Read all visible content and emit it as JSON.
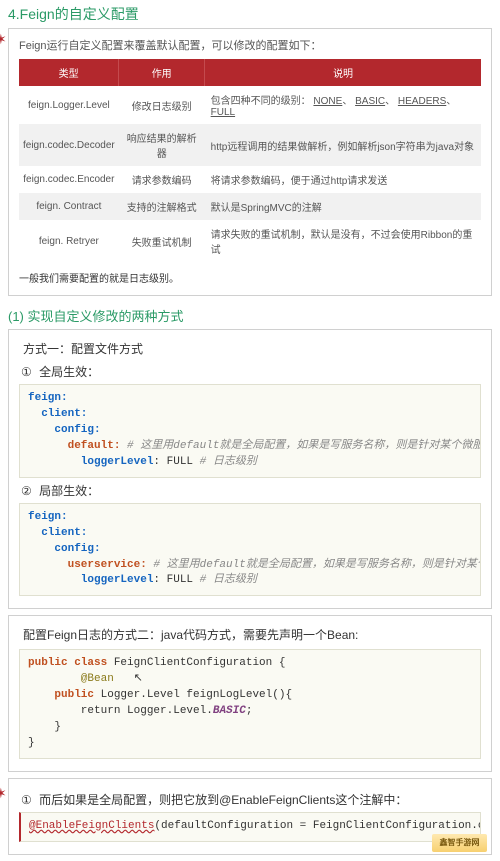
{
  "title_main": "4.Feign的自定义配置",
  "intro": "Feign运行自定义配置来覆盖默认配置，可以修改的配置如下：",
  "table": {
    "headers": [
      "类型",
      "作用",
      "说明"
    ],
    "rows": [
      {
        "c1": "feign.Logger.Level",
        "c2": "修改日志级别",
        "c3_pre": "包含四种不同的级别：",
        "c3_u1": "NONE",
        "c3_u2": "BASIC",
        "c3_u3": "HEADERS",
        "c3_u4": "FULL"
      },
      {
        "c1": "feign.codec.Decoder",
        "c2": "响应结果的解析器",
        "c3": "http远程调用的结果做解析，例如解析json字符串为java对象"
      },
      {
        "c1": "feign.codec.Encoder",
        "c2": "请求参数编码",
        "c3": "将请求参数编码，便于通过http请求发送"
      },
      {
        "c1": "feign. Contract",
        "c2": "支持的注解格式",
        "c3": "默认是SpringMVC的注解"
      },
      {
        "c1": "feign. Retryer",
        "c2": "失败重试机制",
        "c3": "请求失败的重试机制，默认是没有，不过会使用Ribbon的重试"
      }
    ]
  },
  "after_table": "一般我们需要配置的就是日志级别。",
  "sub_title": "(1)  实现自定义修改的两种方式",
  "method1_title": "方式一：配置文件方式",
  "step1_num": "①",
  "step1_label": "全局生效：",
  "code1": {
    "l1": "feign:",
    "l2": "  client:",
    "l3": "    config:",
    "l4a": "      default:",
    "l4c": " # 这里用default就是全局配置，如果是写服务名称，则是针对某个微服务的配置",
    "l5a": "        loggerLevel",
    "l5b": ": FULL ",
    "l5c": "# 日志级别"
  },
  "step2_num": "②",
  "step2_label": "局部生效：",
  "code2": {
    "l1": "feign:",
    "l2": "  client:",
    "l3": "    config:",
    "l4a": "      userservice:",
    "l4c": " # 这里用default就是全局配置，如果是写服务名称，则是针对某个微服务的配置",
    "l5a": "        loggerLevel",
    "l5b": ": FULL ",
    "l5c": "# 日志级别"
  },
  "method2_title": "配置Feign日志的方式二：java代码方式，需要先声明一个Bean:",
  "code3": {
    "l1": "public class FeignClientConfiguration {",
    "l2": "    @Bean",
    "l3": "    public Logger.Level feignLogLevel(){",
    "l4": "        return Logger.Level.BASIC;",
    "l4a": "        return Logger.Level.",
    "l4b": "BASIC",
    "l4c": ";",
    "l5": "    }",
    "l6": "}"
  },
  "step3_num": "①",
  "step3_text": "而后如果是全局配置，则把它放到@EnableFeignClients这个注解中：",
  "code4": {
    "ann": "@EnableFeignClients",
    "rest": "(defaultConfiguration = FeignClientConfiguration.class)"
  },
  "corner_logo": "鑫智手游网"
}
